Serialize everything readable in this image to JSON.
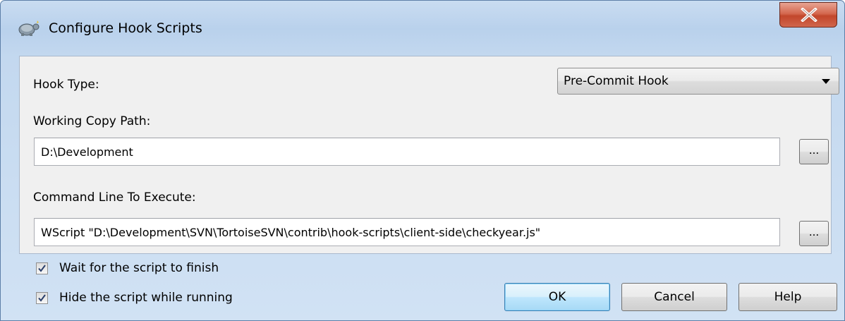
{
  "window": {
    "title": "Configure Hook Scripts",
    "icon": "tortoise-app-icon",
    "close_icon": "close-icon"
  },
  "hook_type": {
    "label": "Hook Type:",
    "selected": "Pre-Commit Hook"
  },
  "working_copy": {
    "label": "Working Copy Path:",
    "value": "D:\\Development",
    "browse_label": "..."
  },
  "command_line": {
    "label": "Command Line To Execute:",
    "value": "WScript \"D:\\Development\\SVN\\TortoiseSVN\\contrib\\hook-scripts\\client-side\\checkyear.js\"",
    "browse_label": "..."
  },
  "options": {
    "wait": {
      "label": "Wait for the script to finish",
      "checked": true
    },
    "hide": {
      "label": "Hide the script while running",
      "checked": true
    }
  },
  "buttons": {
    "ok": "OK",
    "cancel": "Cancel",
    "help": "Help"
  }
}
